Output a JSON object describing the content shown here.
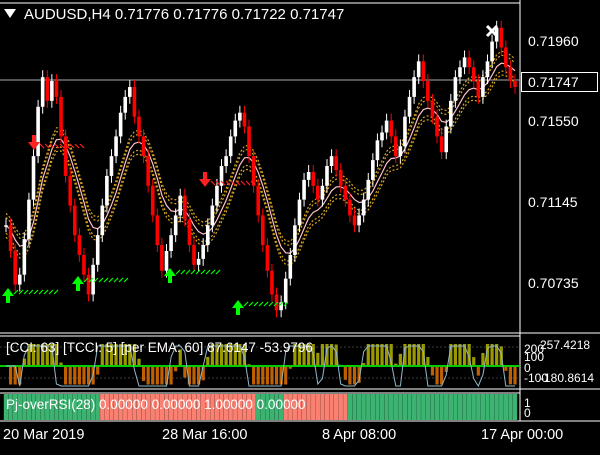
{
  "chart_window": {
    "symbol_tf": "AUDUSD,H4",
    "ohlc": [
      "0.71776",
      "0.71776",
      "0.71722",
      "0.71747"
    ],
    "current_price": "0.71747",
    "price_ticks": [
      "0.71960",
      "0.71550",
      "0.71145",
      "0.70735"
    ],
    "price_range": [
      0.7052,
      0.7215
    ]
  },
  "indicator_1": {
    "label": "[CCI: 63] [TCCI: 5] [per EMA: 60]  87.6147 -53.9796",
    "ticks": [
      "257.4218",
      "200",
      "100",
      "0",
      "-100",
      "-180.8614"
    ]
  },
  "indicator_2": {
    "label": "Pj-overRSI(28) 0.00000 0.00000 1.00000 0.00000",
    "ticks": [
      "1",
      "0"
    ]
  },
  "time_axis": {
    "labels": [
      "20 Mar 2019",
      "28 Mar 16:00",
      "8 Apr 08:00",
      "17 Apr 00:00"
    ]
  },
  "colors": {
    "background": "#000000",
    "bull_candle": "#ffffff",
    "bear_candle": "#ff0000",
    "ema_line": "#ffc0cb",
    "band_line": "#daa520",
    "buy_arrow": "#00ff00",
    "sell_arrow": "#ff2020",
    "histogram": "#9a9a00",
    "rsi_green": "#3cb371",
    "rsi_red": "#fa8072"
  },
  "chart_data": {
    "type": "candlestick",
    "closes": [
      0.7105,
      0.7092,
      0.7075,
      0.708,
      0.7098,
      0.7118,
      0.714,
      0.7165,
      0.718,
      0.7168,
      0.7178,
      0.717,
      0.715,
      0.713,
      0.7115,
      0.71,
      0.709,
      0.708,
      0.707,
      0.7085,
      0.71,
      0.7115,
      0.713,
      0.714,
      0.715,
      0.7162,
      0.717,
      0.7175,
      0.716,
      0.715,
      0.714,
      0.7125,
      0.711,
      0.7095,
      0.7082,
      0.7092,
      0.71,
      0.711,
      0.712,
      0.7108,
      0.7095,
      0.7085,
      0.7088,
      0.7095,
      0.7105,
      0.7115,
      0.7125,
      0.7135,
      0.714,
      0.715,
      0.7158,
      0.7162,
      0.7155,
      0.714,
      0.7125,
      0.711,
      0.7095,
      0.7082,
      0.707,
      0.7062,
      0.7066,
      0.7078,
      0.709,
      0.7105,
      0.7118,
      0.7128,
      0.7132,
      0.7125,
      0.7118,
      0.7125,
      0.7135,
      0.714,
      0.7133,
      0.7125,
      0.7118,
      0.711,
      0.7105,
      0.711,
      0.7118,
      0.7128,
      0.7138,
      0.7148,
      0.7152,
      0.7158,
      0.715,
      0.714,
      0.7145,
      0.716,
      0.717,
      0.718,
      0.7188,
      0.7178,
      0.7168,
      0.716,
      0.715,
      0.7142,
      0.7155,
      0.7168,
      0.718,
      0.7185,
      0.719,
      0.7185,
      0.7178,
      0.717,
      0.718,
      0.7188,
      0.7198,
      0.7205,
      0.7195,
      0.7185,
      0.7178,
      0.7175
    ]
  }
}
